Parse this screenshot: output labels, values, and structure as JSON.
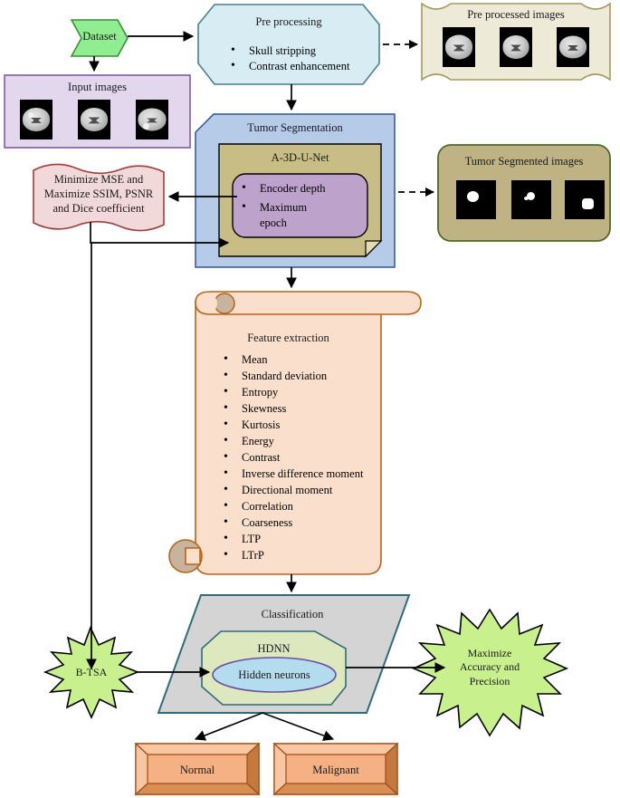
{
  "diagram": {
    "title": "Brain tumor segmentation and classification pipeline",
    "type": "flowchart"
  },
  "nodes": {
    "dataset": {
      "label": "Dataset",
      "fill": "#90ee90",
      "stroke": "#3c8c3c"
    },
    "input_images": {
      "label": "Input images",
      "fill": "#e3d7ee",
      "stroke": "#7b5ea7"
    },
    "preprocessing": {
      "label": "Pre processing",
      "fill": "#d8ecf3",
      "stroke": "#4a7f8c",
      "bullets": [
        "Skull stripping",
        "Contrast enhancement"
      ]
    },
    "preprocessed_images": {
      "label": "Pre processed images",
      "fill": "#eeead8",
      "stroke": "#a39a5e"
    },
    "tumor_segmentation": {
      "label": "Tumor Segmentation",
      "fill": "#b6cbe8",
      "stroke": "#2f5596"
    },
    "a3dunet": {
      "label": "A-3D-U-Net",
      "fill": "#c8bd85",
      "stroke": "#000000"
    },
    "unet_params": {
      "fill": "#bda3cc",
      "stroke": "#000000",
      "bullets": [
        "Encoder depth",
        "Maximum epoch"
      ]
    },
    "metrics": {
      "lines": [
        "Minimize MSE and",
        "Maximize SSIM, PSNR",
        "and Dice coefficient"
      ],
      "fill": "#f2d9d9",
      "stroke": "#a33b3b"
    },
    "tumor_segmented_images": {
      "label": "Tumor Segmented images",
      "fill": "#bfb383",
      "stroke": "#4b6b26"
    },
    "feature_extraction": {
      "label": "Feature extraction",
      "fill": "#fae0cc",
      "stroke": "#b5651d",
      "bullets": [
        "Mean",
        "Standard deviation",
        "Entropy",
        "Skewness",
        "Kurtosis",
        "Energy",
        "Contrast",
        "Inverse difference moment",
        "Directional moment",
        "Correlation",
        "Coarseness",
        "LTP",
        "LTrP"
      ]
    },
    "classification": {
      "label": "Classification",
      "fill": "#d4d4d4",
      "stroke": "#2f6b7b"
    },
    "hdnn": {
      "label": "HDNN",
      "fill": "#dde8bf",
      "stroke": "#2f6b7b"
    },
    "hidden_neurons": {
      "label": "Hidden neurons",
      "fill": "#b3dcef",
      "stroke": "#6b4fa0"
    },
    "btsa": {
      "label": "B-TSA",
      "fill": "#c8f08c",
      "stroke": "#000000"
    },
    "maximize_accuracy": {
      "lines": [
        "Maximize",
        "Accuracy and",
        "Precision"
      ],
      "fill": "#c8f08c",
      "stroke": "#000000"
    },
    "normal": {
      "label": "Normal",
      "fill": "#f5b183",
      "stroke": "#9c4e17"
    },
    "malignant": {
      "label": "Malignant",
      "fill": "#f5b183",
      "stroke": "#9c4e17"
    }
  },
  "edges": [
    {
      "name": "dataset-to-preprocessing",
      "style": "solid-arrow"
    },
    {
      "name": "dataset-to-input-images",
      "style": "solid-arrow"
    },
    {
      "name": "preprocessing-to-preprocessed-images",
      "style": "dashed-arrow"
    },
    {
      "name": "preprocessing-to-tumor-segmentation",
      "style": "solid-arrow"
    },
    {
      "name": "tumor-segmentation-to-metrics",
      "style": "solid-arrow"
    },
    {
      "name": "metrics-to-unet-params",
      "style": "solid-arrow"
    },
    {
      "name": "tumor-segmentation-to-segmented-images",
      "style": "dashed-arrow"
    },
    {
      "name": "tumor-segmentation-to-feature-extraction",
      "style": "solid-arrow"
    },
    {
      "name": "feature-extraction-to-classification",
      "style": "solid-arrow"
    },
    {
      "name": "btsa-to-hidden-neurons",
      "style": "solid-arrow"
    },
    {
      "name": "segmentation-to-btsa",
      "style": "solid-arrow"
    },
    {
      "name": "classification-to-maximize-accuracy",
      "style": "solid-arrow"
    },
    {
      "name": "classification-to-normal",
      "style": "solid-arrow"
    },
    {
      "name": "classification-to-malignant",
      "style": "solid-arrow"
    }
  ]
}
